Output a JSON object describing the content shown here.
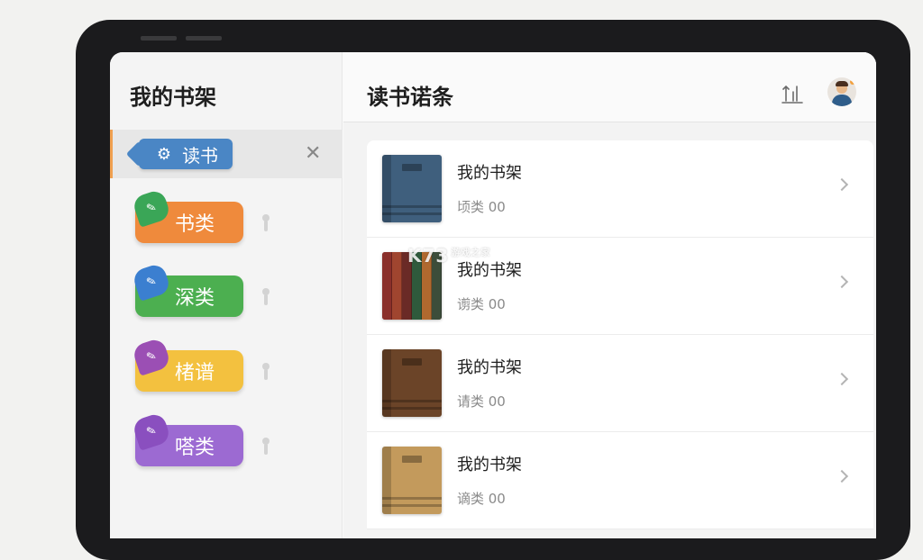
{
  "sidebar": {
    "title": "我的书架",
    "active_item": {
      "label": "读书",
      "icon": "gear-icon",
      "color": "#4a86c5"
    },
    "items": [
      {
        "label": "书类",
        "color": "#ef8a3c",
        "badge_color": "#3aa657"
      },
      {
        "label": "深类",
        "color": "#4caf50",
        "badge_color": "#3b7fd0"
      },
      {
        "label": "楮谱",
        "color": "#f3c13f",
        "badge_color": "#9b4fb4"
      },
      {
        "label": "嗒类",
        "color": "#9c6ad2",
        "badge_color": "#8a4fbf"
      }
    ]
  },
  "main": {
    "title": "读书诺条",
    "books": [
      {
        "title": "我的书架",
        "subtitle": "顷类 00",
        "cover_color": "#3f5f7d"
      },
      {
        "title": "我的书架",
        "subtitle": "谫类 00",
        "cover_color": "#8c3a2e"
      },
      {
        "title": "我的书架",
        "subtitle": "请类 00",
        "cover_color": "#6b4428"
      },
      {
        "title": "我的书架",
        "subtitle": "谪类 00",
        "cover_color": "#c39a5c"
      }
    ]
  },
  "watermark": {
    "text": "K73",
    "sub": "游戏之家"
  }
}
